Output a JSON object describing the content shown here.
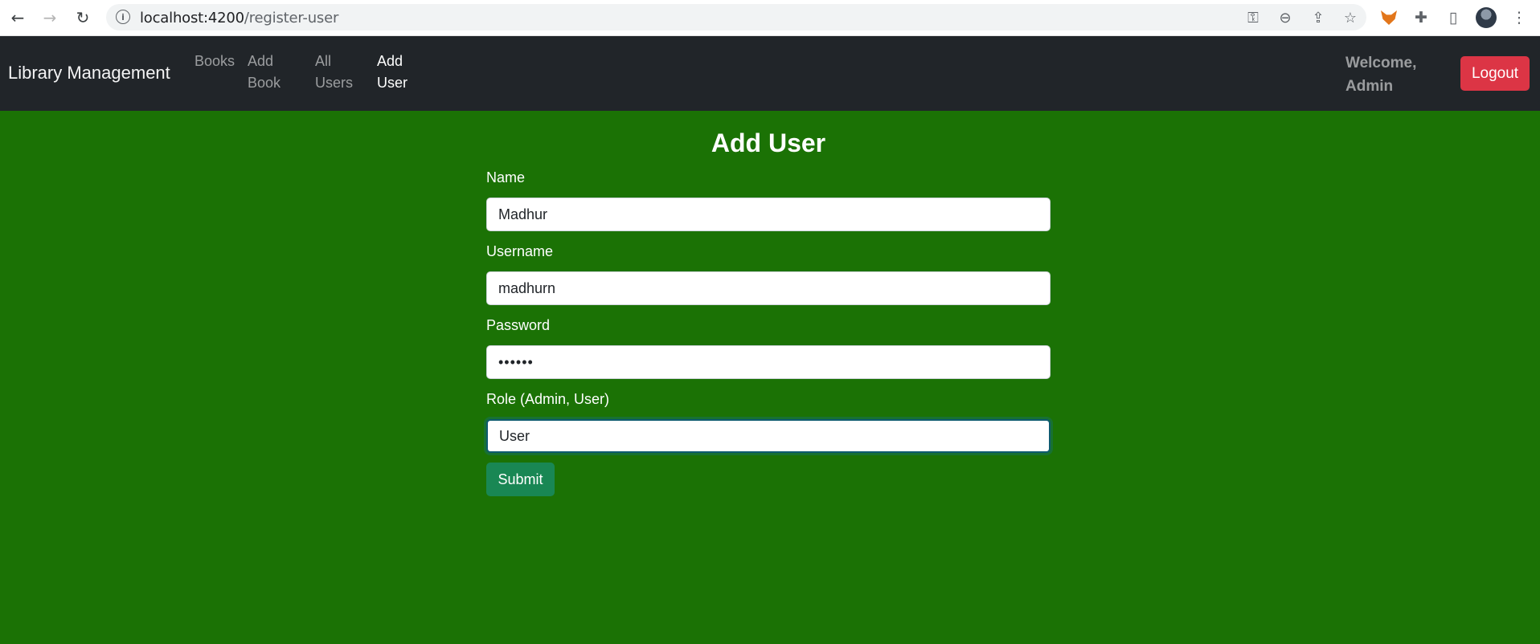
{
  "browser": {
    "url_host": "localhost:4200",
    "url_path": "/register-user"
  },
  "navbar": {
    "brand": "Library Management",
    "links": [
      {
        "line1": "Books",
        "line2": ""
      },
      {
        "line1": "Add",
        "line2": "Book"
      },
      {
        "line1": "All",
        "line2": "Users"
      },
      {
        "line1": "Add",
        "line2": "User"
      }
    ],
    "active_link": "Add User",
    "welcome_line1": "Welcome,",
    "welcome_line2": "Admin",
    "logout_label": "Logout"
  },
  "form": {
    "title": "Add User",
    "fields": [
      {
        "label": "Name",
        "value": "Madhur",
        "type": "text"
      },
      {
        "label": "Username",
        "value": "madhurn",
        "type": "text"
      },
      {
        "label": "Password",
        "value": "••••••",
        "type": "password"
      },
      {
        "label": "Role (Admin, User)",
        "value": "User",
        "type": "text"
      }
    ],
    "submit_label": "Submit"
  },
  "colors": {
    "page_background": "#1b7205",
    "navbar_background": "#212529",
    "logout_button": "#dc3545",
    "submit_button": "#198754"
  }
}
